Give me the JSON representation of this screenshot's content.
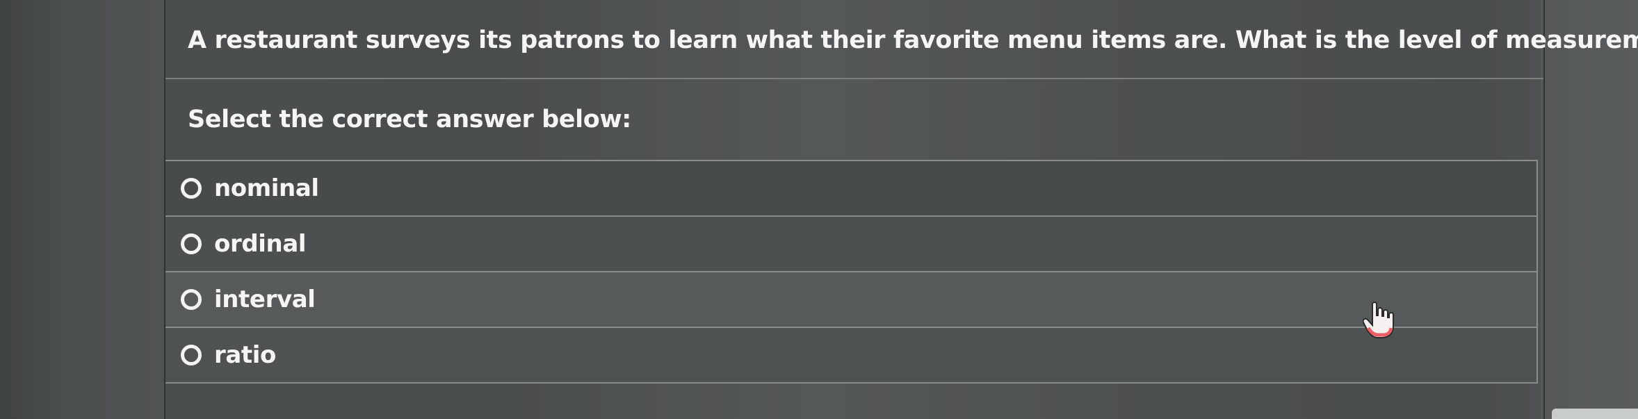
{
  "question": {
    "text": "A restaurant surveys its patrons to learn what their favorite menu items are.  What is the level of measurement of the data?"
  },
  "instruction": "Select the correct answer below:",
  "options": [
    {
      "label": "nominal"
    },
    {
      "label": "ordinal"
    },
    {
      "label": "interval"
    },
    {
      "label": "ratio"
    }
  ],
  "selected_option": null,
  "icons": {
    "radio": "radio-circle-icon",
    "cursor": "hand-pointer-icon"
  },
  "colors": {
    "text": "#f4f5f5",
    "background": "#4b4e4e",
    "border": "#8b8e8e",
    "cursor_accent": "#e8464e"
  }
}
